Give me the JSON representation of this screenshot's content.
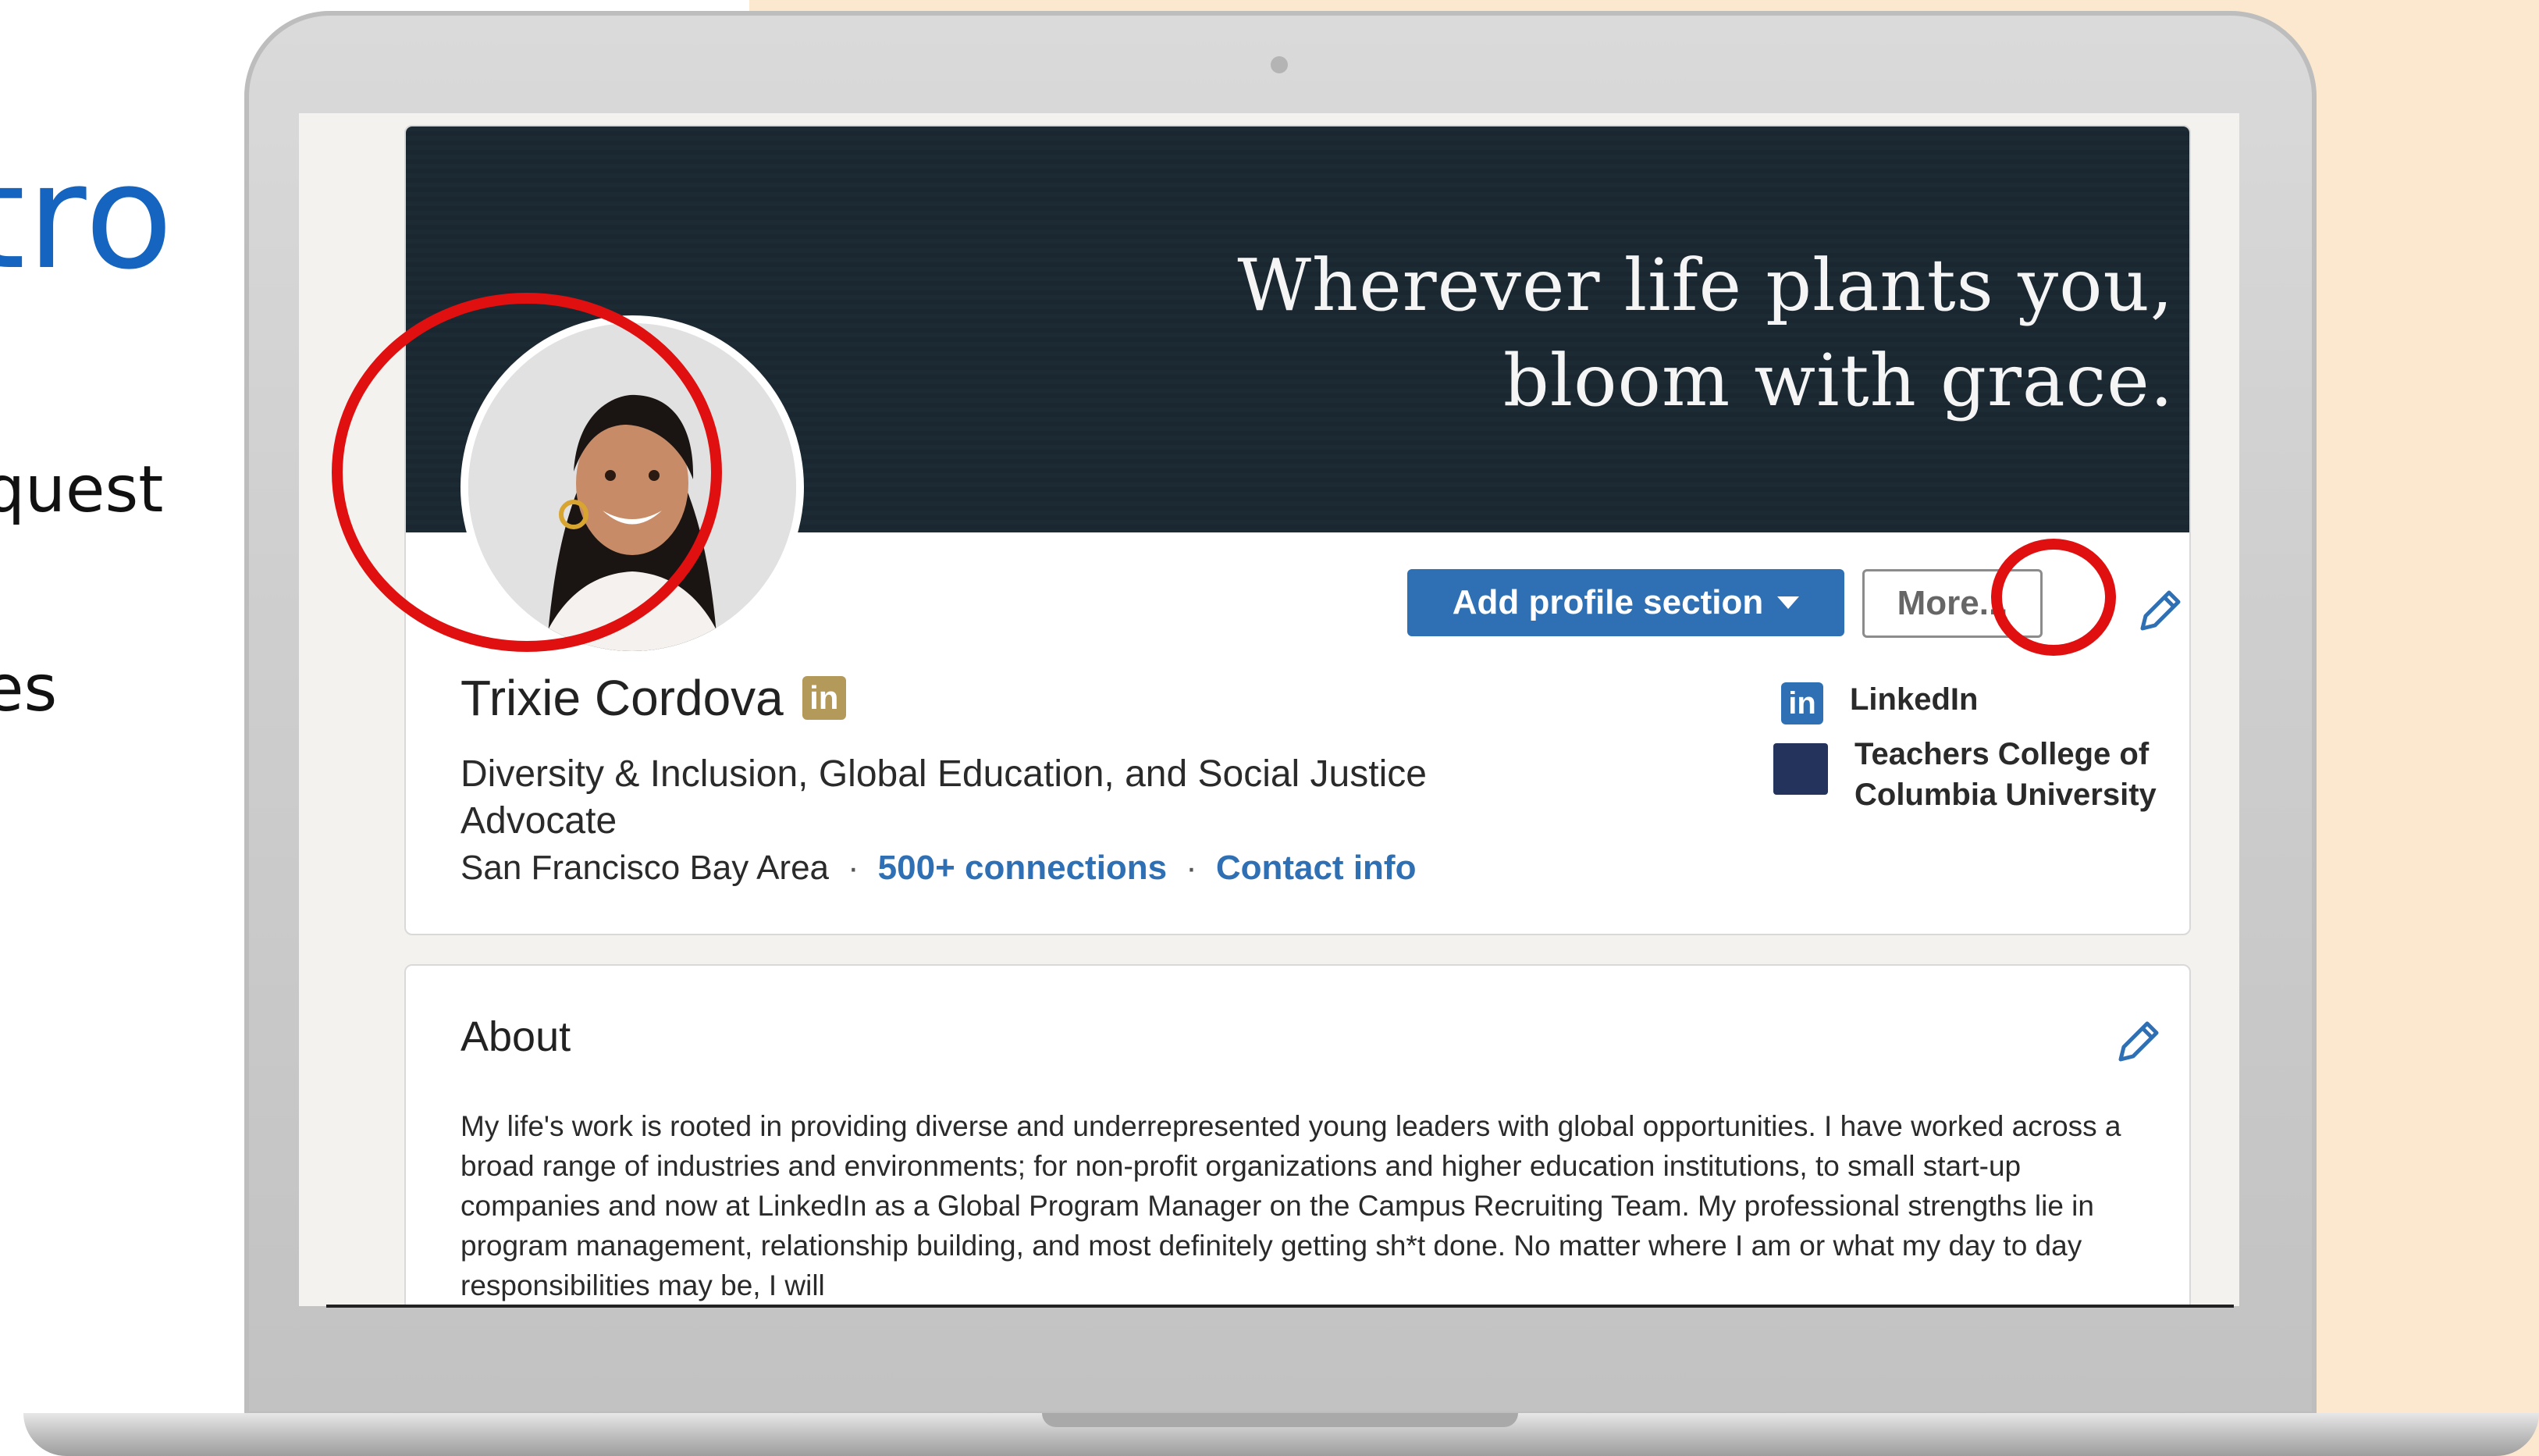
{
  "slide": {
    "title_fragment": "tro",
    "bullet_1": "quest",
    "bullet_2": "es"
  },
  "banner": {
    "quote_line_1": "Wherever life plants you,",
    "quote_line_2": "bloom with grace."
  },
  "profile": {
    "name": "Trixie Cordova",
    "badge": "in",
    "headline": "Diversity & Inclusion, Global Education, and Social Justice Advocate",
    "location": "San Francisco Bay Area",
    "connections": "500+ connections",
    "contact_info": "Contact info",
    "separator": "·"
  },
  "actions": {
    "add_profile_section": "Add profile section",
    "more": "More..."
  },
  "side": {
    "company_icon": "in",
    "company": "LinkedIn",
    "school_line_1": "Teachers College of",
    "school_line_2": "Columbia University"
  },
  "about": {
    "title": "About",
    "text": "My life's work is rooted in providing diverse and underrepresented young leaders with global opportunities. I have worked across a broad range of industries and environments; for non-profit organizations and higher education institutions, to small start-up companies and now at LinkedIn as a Global Program Manager on the Campus Recruiting Team. My professional strengths lie in program management, relationship building, and most definitely getting sh*t done. No matter where I am or what my day to day responsibilities may be, I will"
  },
  "colors": {
    "accent_blue": "#2f6fb3",
    "highlight_red": "#e01010",
    "banner_dark": "#1c2a33",
    "slide_title_blue": "#1565c0",
    "peach_background": "#fbe8cf"
  },
  "icons": [
    "pencil-icon",
    "linkedin-icon",
    "caret-down-icon",
    "college-logo-icon",
    "camera-icon"
  ]
}
